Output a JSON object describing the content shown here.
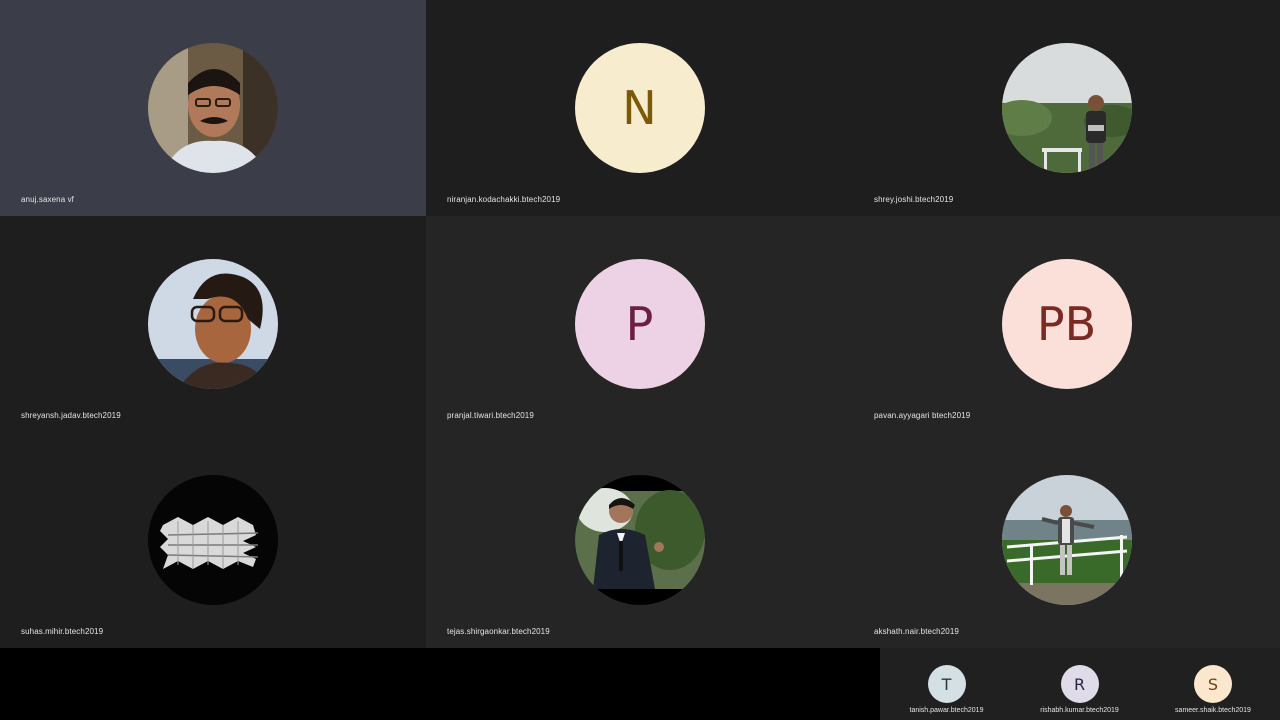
{
  "participants": [
    {
      "name": "anuj.saxena vf",
      "avatar": "photo-man-glasses-icon"
    },
    {
      "name": "niranjan.kodachakki.btech2019",
      "initials": "N",
      "bg": "#f8eccf",
      "fg": "#7a5a08"
    },
    {
      "name": "shrey.joshi.btech2019",
      "avatar": "photo-man-landscape-icon"
    },
    {
      "name": "shreyansh.jadav.btech2019",
      "avatar": "photo-man-sky-icon"
    },
    {
      "name": "pranjal.tiwari.btech2019",
      "initials": "P",
      "bg": "#ecd2e4",
      "fg": "#6b1f44"
    },
    {
      "name": "pavan.ayyagari btech2019",
      "initials": "PB",
      "bg": "#fbe0da",
      "fg": "#7a2a22"
    },
    {
      "name": "suhas.mihir.btech2019",
      "avatar": "paper-fold-icon"
    },
    {
      "name": "tejas.shirgaonkar.btech2019",
      "avatar": "photo-man-suit-icon"
    },
    {
      "name": "akshath.nair.btech2019",
      "avatar": "photo-man-railing-icon"
    }
  ],
  "overflow_participants": [
    {
      "name": "tanish.pawar.btech2019",
      "initials": "T",
      "bg": "#d4e0e4",
      "fg": "#1f3a44"
    },
    {
      "name": "rishabh.kumar.btech2019",
      "initials": "R",
      "bg": "#e0dbe8",
      "fg": "#2f2548"
    },
    {
      "name": "sameer.shaik.btech2019",
      "initials": "S",
      "bg": "#fbe7cd",
      "fg": "#6b4410"
    }
  ],
  "colors": {
    "active_tile": "#3b3d49",
    "tile": "#222222",
    "background": "#000000"
  }
}
